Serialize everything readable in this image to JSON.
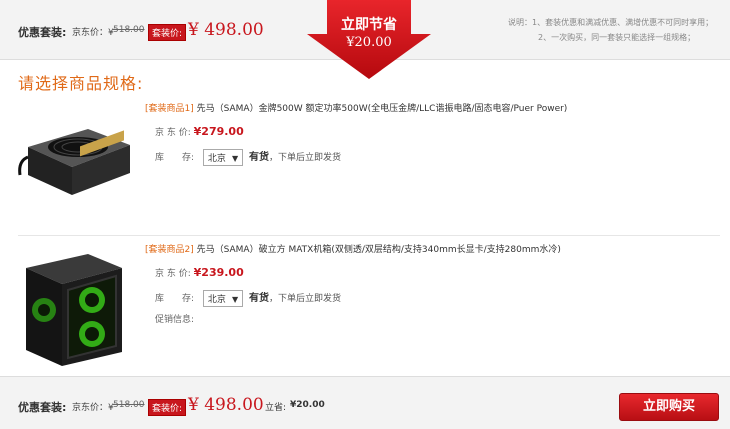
{
  "top_bar": {
    "title": "优惠套装:",
    "jd_price_label": "京东价：¥",
    "jd_price_value": "518.00",
    "bundle_tag": "套装价:",
    "bundle_price": "¥ 498.00",
    "note_line1": "说明：1、套装优惠和满减优惠、满增优惠不可同时享用；",
    "note_line2": "2、一次购买，同一套装只能选择一组规格；"
  },
  "badge": {
    "title": "立即节省",
    "amount": "¥20.00"
  },
  "choose_title": "请选择商品规格:",
  "products": [
    {
      "tag": "[套装商品1]",
      "name": "先马（SAMA）金牌500W 额定功率500W(全电压金牌/LLC谐振电路/固态电容/Puer Power)",
      "price_label": "京 东 价:",
      "price": "¥279.00",
      "stock_label": "库　　存:",
      "region": "北京",
      "stock": "有货",
      "ship": "，下单后立即发货"
    },
    {
      "tag": "[套装商品2]",
      "name": "先马（SAMA）破立方 MATX机箱(双侧透/双层结构/支持340mm长显卡/支持280mm水冷)",
      "price_label": "京 东 价:",
      "price": "¥239.00",
      "stock_label": "库　　存:",
      "region": "北京",
      "stock": "有货",
      "ship": "，下单后立即发货",
      "promo_label": "促销信息:"
    }
  ],
  "bottom_bar": {
    "title": "优惠套装:",
    "jd_price_label": "京东价：¥",
    "jd_price_value": "518.00",
    "bundle_tag": "套装价:",
    "bundle_price": "¥ 498.00",
    "save_label": "立省:",
    "save_value": "¥20.00",
    "buy_button": "立即购买"
  },
  "colors": {
    "accent_red": "#c8161d",
    "accent_orange": "#e06a18"
  }
}
